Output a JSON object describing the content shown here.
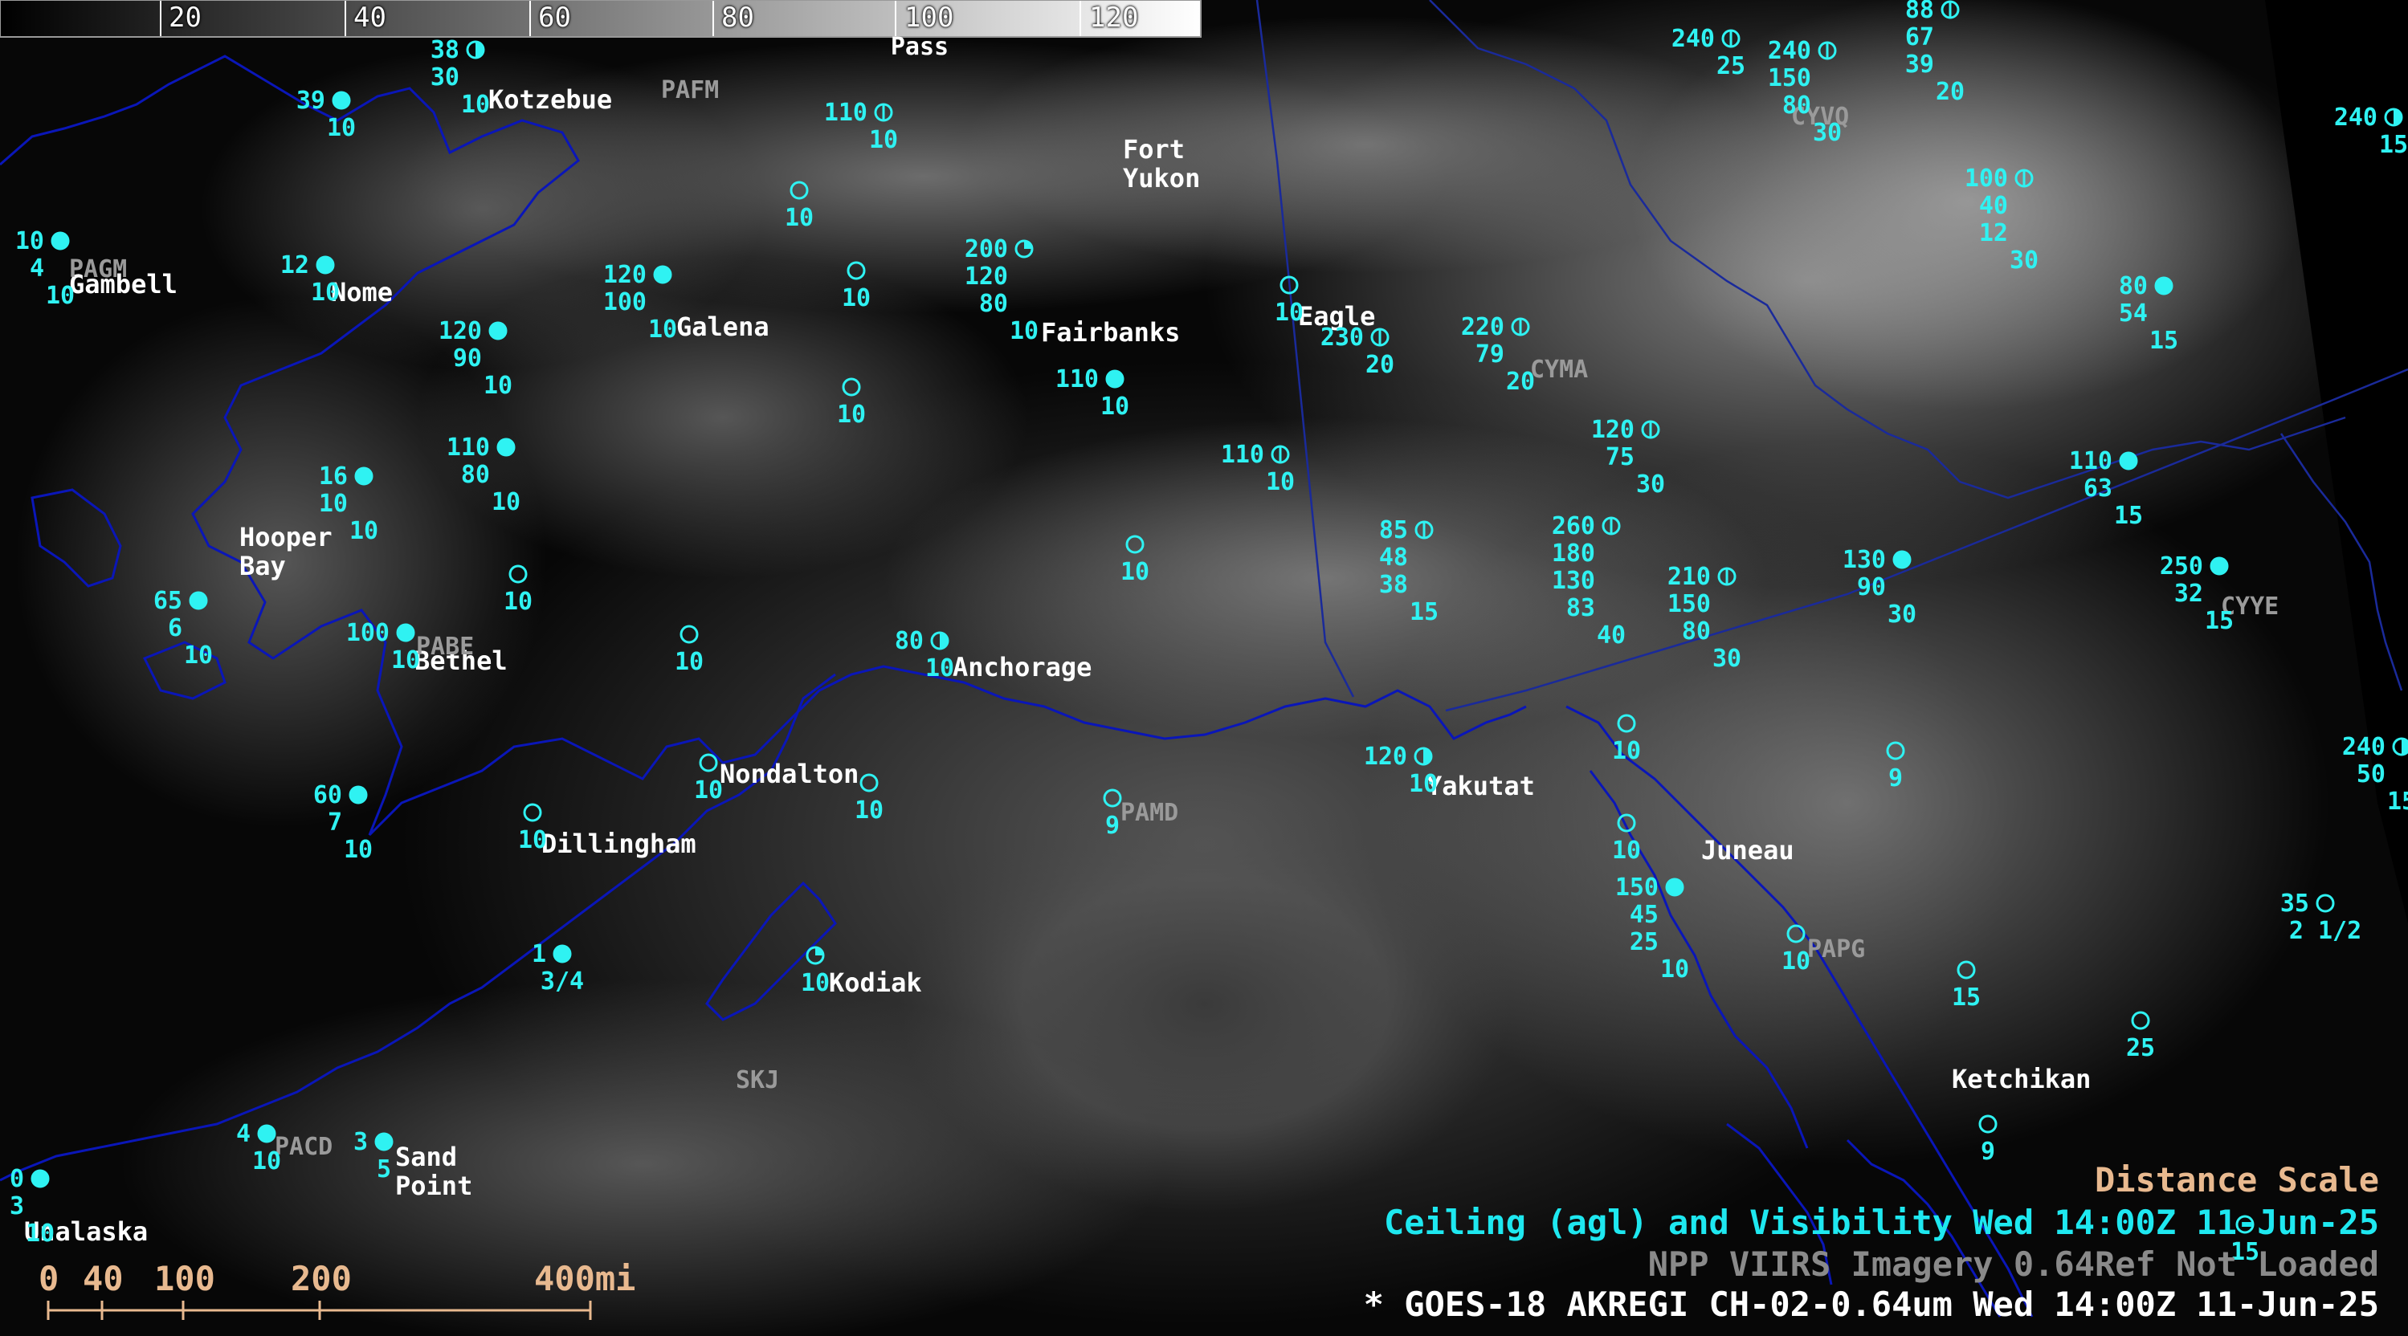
{
  "colorbar": {
    "ticks": [
      "20",
      "40",
      "60",
      "80",
      "100",
      "120"
    ]
  },
  "top_label": "Pass",
  "cities": [
    {
      "name": "Kotzebue"
    },
    {
      "name": "Gambell"
    },
    {
      "name": "Nome"
    },
    {
      "name": "Galena"
    },
    {
      "name": "Fort Yukon"
    },
    {
      "name": "Fairbanks"
    },
    {
      "name": "Eagle"
    },
    {
      "name": "Hooper Bay"
    },
    {
      "name": "Bethel"
    },
    {
      "name": "Anchorage"
    },
    {
      "name": "Nondalton"
    },
    {
      "name": "Dillingham"
    },
    {
      "name": "Yakutat"
    },
    {
      "name": "Juneau"
    },
    {
      "name": "Kodiak"
    },
    {
      "name": "Ketchikan"
    },
    {
      "name": "Sand Point"
    },
    {
      "name": "Unalaska"
    }
  ],
  "station_ids": [
    "PAFM",
    "PAGM",
    "CYVQ",
    "CYMA",
    "PABE",
    "PAMD",
    "SKJ",
    "PAPG",
    "CYYE",
    "PACD"
  ],
  "observations": [
    {
      "ceiling": "38 30",
      "vis": "10"
    },
    {
      "ceiling": "39",
      "vis": "10"
    },
    {
      "ceiling": "10 4",
      "vis": "10"
    },
    {
      "ceiling": "12",
      "vis": "10"
    },
    {
      "ceiling": "110",
      "vis": "10"
    },
    {
      "ceiling": "",
      "vis": "10"
    },
    {
      "ceiling": "",
      "vis": "10"
    },
    {
      "ceiling": "120 100",
      "vis": "10"
    },
    {
      "ceiling": "120 90",
      "vis": "10"
    },
    {
      "ceiling": "",
      "vis": "10"
    },
    {
      "ceiling": "200 120 80",
      "vis": "10"
    },
    {
      "ceiling": "110",
      "vis": "10"
    },
    {
      "ceiling": "",
      "vis": "10"
    },
    {
      "ceiling": "230",
      "vis": "20"
    },
    {
      "ceiling": "220 79",
      "vis": "20"
    },
    {
      "ceiling": "240",
      "vis": "25"
    },
    {
      "ceiling": "240 150 80",
      "vis": "30"
    },
    {
      "ceiling": "88 67 39",
      "vis": "20"
    },
    {
      "ceiling": "100 40 12",
      "vis": "30"
    },
    {
      "ceiling": "80 54",
      "vis": "15"
    },
    {
      "ceiling": "240",
      "vis": "15"
    },
    {
      "ceiling": "110 80",
      "vis": "10"
    },
    {
      "ceiling": "16 10",
      "vis": "10"
    },
    {
      "ceiling": "110",
      "vis": "10"
    },
    {
      "ceiling": "",
      "vis": "10"
    },
    {
      "ceiling": "120 75",
      "vis": "30"
    },
    {
      "ceiling": "110 63",
      "vis": "15"
    },
    {
      "ceiling": "85 48 38",
      "vis": "15"
    },
    {
      "ceiling": "260 180 130 83",
      "vis": "40"
    },
    {
      "ceiling": "210 150 80",
      "vis": "30"
    },
    {
      "ceiling": "130 90",
      "vis": "30"
    },
    {
      "ceiling": "250 32",
      "vis": "15"
    },
    {
      "ceiling": "65 6",
      "vis": "10"
    },
    {
      "ceiling": "100",
      "vis": "10"
    },
    {
      "ceiling": "",
      "vis": "10"
    },
    {
      "ceiling": "80",
      "vis": "10"
    },
    {
      "ceiling": "",
      "vis": "10"
    },
    {
      "ceiling": "",
      "vis": "10"
    },
    {
      "ceiling": "",
      "vis": "10"
    },
    {
      "ceiling": "120",
      "vis": "10"
    },
    {
      "ceiling": "",
      "vis": "10"
    },
    {
      "ceiling": "",
      "vis": "9"
    },
    {
      "ceiling": "",
      "vis": "9"
    },
    {
      "ceiling": "60 7",
      "vis": "10"
    },
    {
      "ceiling": "",
      "vis": "10"
    },
    {
      "ceiling": "240 50",
      "vis": "15"
    },
    {
      "ceiling": "150 45 25",
      "vis": "10"
    },
    {
      "ceiling": "",
      "vis": "10"
    },
    {
      "ceiling": "35",
      "vis": "2 1/2"
    },
    {
      "ceiling": "1",
      "vis": "3/4"
    },
    {
      "ceiling": "",
      "vis": "10"
    },
    {
      "ceiling": "",
      "vis": "15"
    },
    {
      "ceiling": "",
      "vis": "25"
    },
    {
      "ceiling": "",
      "vis": "10"
    },
    {
      "ceiling": "",
      "vis": "9"
    },
    {
      "ceiling": "4",
      "vis": "10"
    },
    {
      "ceiling": "3",
      "vis": "5"
    },
    {
      "ceiling": "0 3",
      "vis": "10"
    },
    {
      "ceiling": "",
      "vis": "15"
    }
  ],
  "legend": {
    "distance_scale": "Distance Scale",
    "product": "Ceiling (agl) and Visibility",
    "product_time": "Wed 14:00Z 11-Jun-25",
    "viirs": "NPP VIIRS Imagery 0.64Ref Not Loaded",
    "goes": "* GOES-18 AKREGI CH-02-0.64um",
    "goes_time": "Wed 14:00Z 11-Jun-25"
  },
  "scale": {
    "labels": [
      "0",
      "40",
      "100",
      "200",
      "400mi"
    ]
  },
  "colors": {
    "obs": "#2ff2f2",
    "coast": "#0a16b8",
    "border": "#1a2a9a",
    "city": "#ffffff",
    "station_id": "#9a9a9a",
    "legend_cyan": "#1ee8f0",
    "legend_tan": "#e8b98f",
    "legend_white": "#ffffff",
    "legend_gray": "#8a8a8a"
  }
}
